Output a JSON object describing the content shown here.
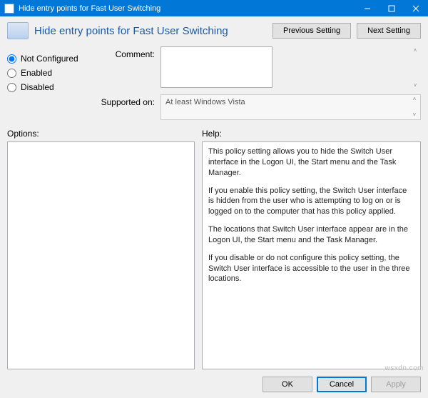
{
  "window": {
    "title": "Hide entry points for Fast User Switching"
  },
  "header": {
    "title": "Hide entry points for Fast User Switching",
    "previous_label": "Previous Setting",
    "next_label": "Next Setting"
  },
  "radios": {
    "not_configured": "Not Configured",
    "enabled": "Enabled",
    "disabled": "Disabled",
    "selected": "not_configured"
  },
  "fields": {
    "comment_label": "Comment:",
    "comment_value": "",
    "supported_label": "Supported on:",
    "supported_value": "At least Windows Vista"
  },
  "panes": {
    "options_label": "Options:",
    "help_label": "Help:",
    "help_paragraphs": [
      "This policy setting allows you to hide the Switch User interface in the Logon UI, the Start menu and the Task Manager.",
      "If you enable this policy setting, the Switch User interface is hidden from the user who is attempting to log on or is logged on to the computer that has this policy applied.",
      "The locations that Switch User interface appear are in the Logon UI, the Start menu and the Task Manager.",
      "If you disable or do not configure this policy setting, the Switch User interface is accessible to the user in the three locations."
    ]
  },
  "buttons": {
    "ok": "OK",
    "cancel": "Cancel",
    "apply": "Apply"
  },
  "watermark": "wsxdn.com"
}
